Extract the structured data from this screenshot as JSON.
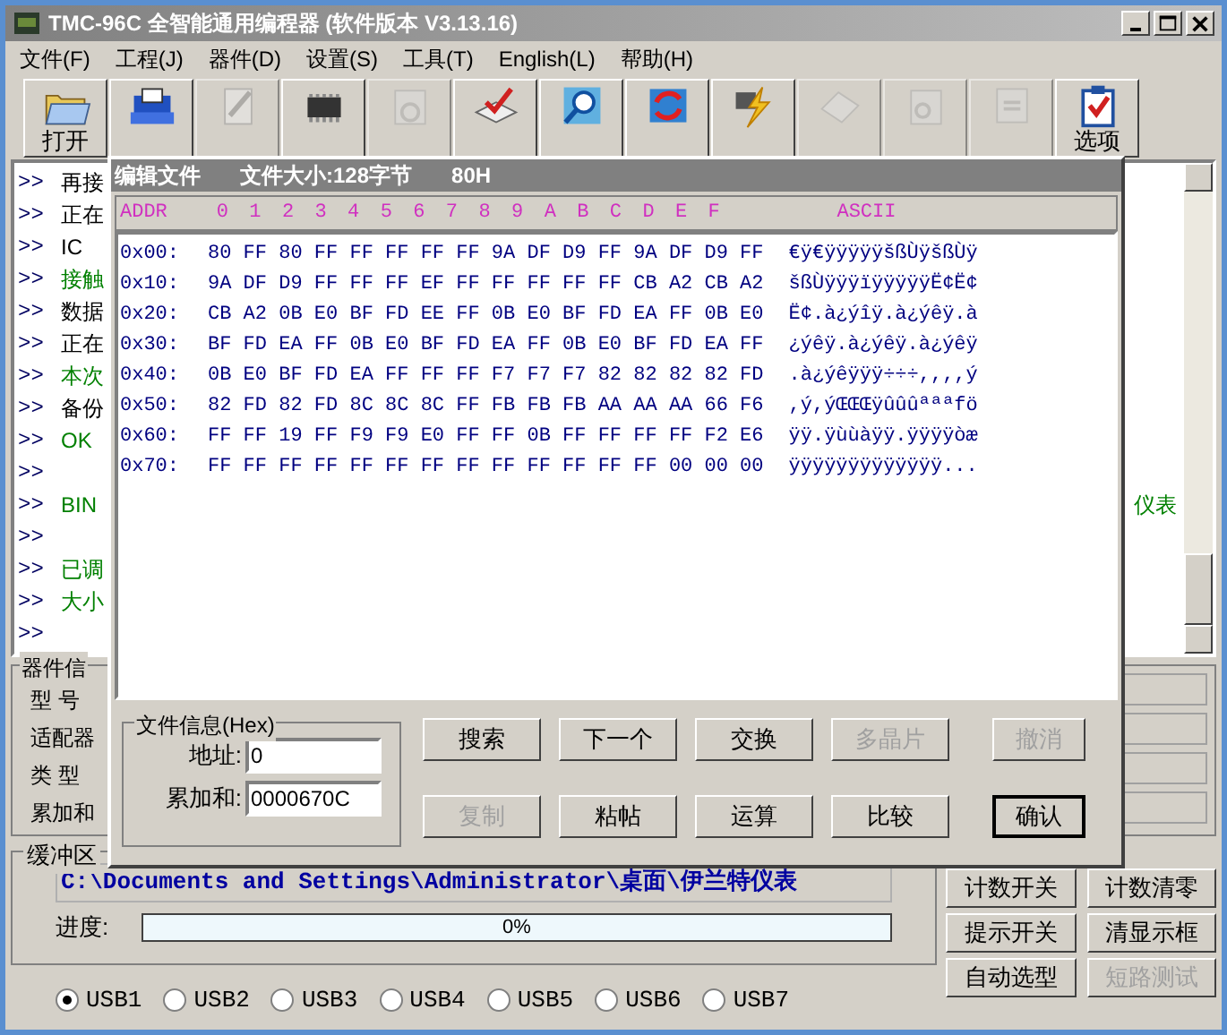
{
  "window": {
    "title": "TMC-96C 全智能通用编程器 (软件版本 V3.13.16)"
  },
  "menu": [
    "文件(F)",
    "工程(J)",
    "器件(D)",
    "设置(S)",
    "工具(T)",
    "English(L)",
    "帮助(H)"
  ],
  "toolbar": [
    {
      "label": "打开",
      "disabled": false
    },
    {
      "disabled": false
    },
    {
      "disabled": true
    },
    {
      "disabled": false
    },
    {
      "disabled": true
    },
    {
      "disabled": false
    },
    {
      "disabled": false
    },
    {
      "disabled": false
    },
    {
      "disabled": false
    },
    {
      "disabled": true
    },
    {
      "disabled": true
    },
    {
      "disabled": true
    },
    {
      "label": "选项",
      "disabled": false
    }
  ],
  "log": [
    {
      "prompt": ">>",
      "text": "再接",
      "color": "#000000"
    },
    {
      "prompt": ">>",
      "text": "正在",
      "color": "#000000"
    },
    {
      "prompt": ">>",
      "text": "IC",
      "color": "#000000"
    },
    {
      "prompt": ">>",
      "text": "接触",
      "color": "#008000"
    },
    {
      "prompt": ">>",
      "text": "数据",
      "color": "#000000"
    },
    {
      "prompt": ">>",
      "text": "正在",
      "color": "#000000"
    },
    {
      "prompt": ">>",
      "text": "本次",
      "color": "#008000"
    },
    {
      "prompt": ">>",
      "text": "备份",
      "color": "#000000"
    },
    {
      "prompt": ">>",
      "text": "OK",
      "color": "#008000"
    },
    {
      "prompt": ">>"
    },
    {
      "prompt": ">>",
      "text": "BIN",
      "color": "#008000",
      "tail": "仪表"
    },
    {
      "prompt": ">>"
    },
    {
      "prompt": ">>",
      "text": "已调",
      "color": "#008000"
    },
    {
      "prompt": ">>",
      "text": "大小",
      "color": "#008000"
    },
    {
      "prompt": ">>"
    }
  ],
  "device_info": {
    "title": "器件信",
    "labels": [
      "型 号",
      "适配器",
      "类 型",
      "累加和"
    ]
  },
  "buffer": {
    "title": "缓冲区",
    "path": "C:\\Documents and Settings\\Administrator\\桌面\\伊兰特仪表",
    "progress_label": "进度:",
    "progress_text": "0%",
    "level": 0
  },
  "side_buttons": [
    {
      "label": "计数开关",
      "disabled": false
    },
    {
      "label": "计数清零",
      "disabled": false
    },
    {
      "label": "提示开关",
      "disabled": false
    },
    {
      "label": "清显示框",
      "disabled": false
    },
    {
      "label": "自动选型",
      "disabled": false
    },
    {
      "label": "短路测试",
      "disabled": true
    }
  ],
  "usb": [
    {
      "label": "USB1",
      "selected": true
    },
    {
      "label": "USB2",
      "selected": false
    },
    {
      "label": "USB3",
      "selected": false
    },
    {
      "label": "USB4",
      "selected": false
    },
    {
      "label": "USB5",
      "selected": false
    },
    {
      "label": "USB6",
      "selected": false
    },
    {
      "label": "USB7",
      "selected": false
    }
  ],
  "dialog": {
    "title": "编辑文件",
    "size": "文件大小:128字节",
    "size_hex": "80H",
    "columns": [
      "ADDR",
      "0",
      "1",
      "2",
      "3",
      "4",
      "5",
      "6",
      "7",
      "8",
      "9",
      "A",
      "B",
      "C",
      "D",
      "E",
      "F",
      "ASCII"
    ],
    "rows": [
      {
        "addr": "0x00:",
        "bytes": "80 FF 80 FF FF FF FF FF 9A DF D9 FF 9A DF D9 FF",
        "ascii": "€ÿ€ÿÿÿÿÿšßÙÿšßÙÿ"
      },
      {
        "addr": "0x10:",
        "bytes": "9A DF D9 FF FF FF EF FF FF FF FF FF CB A2 CB A2",
        "ascii": "šßÙÿÿÿïÿÿÿÿÿË¢Ë¢"
      },
      {
        "addr": "0x20:",
        "bytes": "CB A2 0B E0 BF FD EE FF 0B E0 BF FD EA FF 0B E0",
        "ascii": "Ë¢.à¿ýîÿ.à¿ýêÿ.à"
      },
      {
        "addr": "0x30:",
        "bytes": "BF FD EA FF 0B E0 BF FD EA FF 0B E0 BF FD EA FF",
        "ascii": "¿ýêÿ.à¿ýêÿ.à¿ýêÿ"
      },
      {
        "addr": "0x40:",
        "bytes": "0B E0 BF FD EA FF FF FF F7 F7 F7 82 82 82 82 FD",
        "ascii": ".à¿ýêÿÿÿ÷÷÷,,,,ý"
      },
      {
        "addr": "0x50:",
        "bytes": "82 FD 82 FD 8C 8C 8C FF FB FB FB AA AA AA 66 F6",
        "ascii": ",ý,ýŒŒŒÿûûûªªªfö"
      },
      {
        "addr": "0x60:",
        "bytes": "FF FF 19 FF F9 F9 E0 FF FF 0B FF FF FF FF F2 E6",
        "ascii": "ÿÿ.ÿùùàÿÿ.ÿÿÿÿòæ"
      },
      {
        "addr": "0x70:",
        "bytes": "FF FF FF FF FF FF FF FF FF FF FF FF FF 00 00 00",
        "ascii": "ÿÿÿÿÿÿÿÿÿÿÿÿÿ..."
      }
    ],
    "file_info": {
      "title": "文件信息(Hex)",
      "address_label": "地址:",
      "address": "0",
      "checksum_label": "累加和:",
      "checksum": "0000670C"
    },
    "buttons": [
      {
        "label": "搜索",
        "disabled": false
      },
      {
        "label": "下一个",
        "disabled": false
      },
      {
        "label": "交换",
        "disabled": false
      },
      {
        "label": "多晶片",
        "disabled": true
      },
      {
        "label": "撤消",
        "disabled": true
      },
      {
        "label": "复制",
        "disabled": true
      },
      {
        "label": "粘帖",
        "disabled": false
      },
      {
        "label": "运算",
        "disabled": false
      },
      {
        "label": "比较",
        "disabled": false
      },
      {
        "label": "确认",
        "disabled": false
      }
    ]
  }
}
